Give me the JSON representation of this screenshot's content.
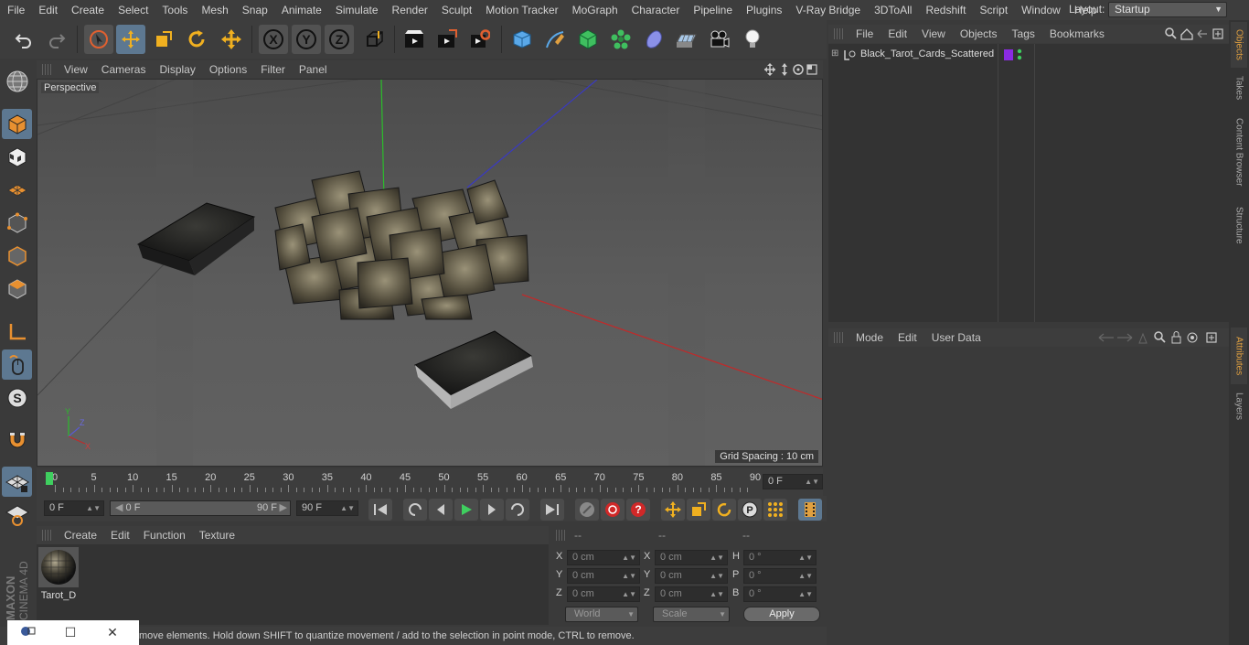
{
  "menubar": {
    "items": [
      "File",
      "Edit",
      "Create",
      "Select",
      "Tools",
      "Mesh",
      "Snap",
      "Animate",
      "Simulate",
      "Render",
      "Sculpt",
      "Motion Tracker",
      "MoGraph",
      "Character",
      "Pipeline",
      "Plugins",
      "V-Ray Bridge",
      "3DToAll",
      "Redshift",
      "Script",
      "Window",
      "Help"
    ],
    "layout_label": "Layout:",
    "layout_value": "Startup"
  },
  "toolbar": {
    "icons": [
      "undo-icon",
      "redo-icon",
      "select-arrow-icon",
      "move-icon",
      "scale-icon",
      "rotate-icon",
      "move-alt-icon",
      "x-axis-icon",
      "y-axis-icon",
      "z-axis-icon",
      "coordinate-system-icon",
      "render-view-icon",
      "render-picture-queue-icon",
      "render-settings-icon",
      "cube-icon",
      "pen-icon",
      "subdivision-icon",
      "cloner-icon",
      "deformer-icon",
      "floor-icon",
      "camera-icon",
      "light-icon"
    ],
    "axis_x": "X",
    "axis_y": "Y",
    "axis_z": "Z"
  },
  "viewport": {
    "menu": [
      "View",
      "Cameras",
      "Display",
      "Options",
      "Filter",
      "Panel"
    ],
    "label": "Perspective",
    "grid_spacing": "Grid Spacing : 10 cm",
    "axis_gizmo": {
      "y": "Y",
      "z": "Z",
      "x": "X"
    }
  },
  "timeline": {
    "ticks": [
      "0",
      "5",
      "10",
      "15",
      "20",
      "25",
      "30",
      "35",
      "40",
      "45",
      "50",
      "55",
      "60",
      "65",
      "70",
      "75",
      "80",
      "85",
      "90"
    ],
    "current_frame": "0 F"
  },
  "transport": {
    "start_field": "0 F",
    "range_start": "0 F",
    "range_end": "90 F",
    "end_field": "90 F"
  },
  "material_manager": {
    "menu": [
      "Create",
      "Edit",
      "Function",
      "Texture"
    ],
    "material_name": "Tarot_D"
  },
  "coordinates": {
    "headers": [
      "--",
      "--",
      "--"
    ],
    "rows": [
      {
        "l1": "X",
        "v1": "0 cm",
        "l2": "X",
        "v2": "0 cm",
        "l3": "H",
        "v3": "0 °"
      },
      {
        "l1": "Y",
        "v1": "0 cm",
        "l2": "Y",
        "v2": "0 cm",
        "l3": "P",
        "v3": "0 °"
      },
      {
        "l1": "Z",
        "v1": "0 cm",
        "l2": "Z",
        "v2": "0 cm",
        "l3": "B",
        "v3": "0 °"
      }
    ],
    "world": "World",
    "scale": "Scale",
    "apply": "Apply"
  },
  "status": {
    "text": "move elements. Hold down SHIFT to quantize movement / add to the selection in point mode, CTRL to remove."
  },
  "object_manager": {
    "menu": [
      "File",
      "Edit",
      "View",
      "Objects",
      "Tags",
      "Bookmarks"
    ],
    "object_name": "Black_Tarot_Cards_Scattered",
    "tag_color": "#8a2be2"
  },
  "attribute_manager": {
    "menu": [
      "Mode",
      "Edit",
      "User Data"
    ]
  },
  "right_tabs": [
    "Objects",
    "Takes",
    "Content Browser",
    "Structure",
    "Attributes",
    "Layers"
  ],
  "brand": {
    "line1": "MAXON",
    "line2": "CINEMA 4D"
  },
  "colors": {
    "accent": "#5d7891",
    "active_tab": "#e0a040",
    "playhead": "#3fcf5f"
  }
}
